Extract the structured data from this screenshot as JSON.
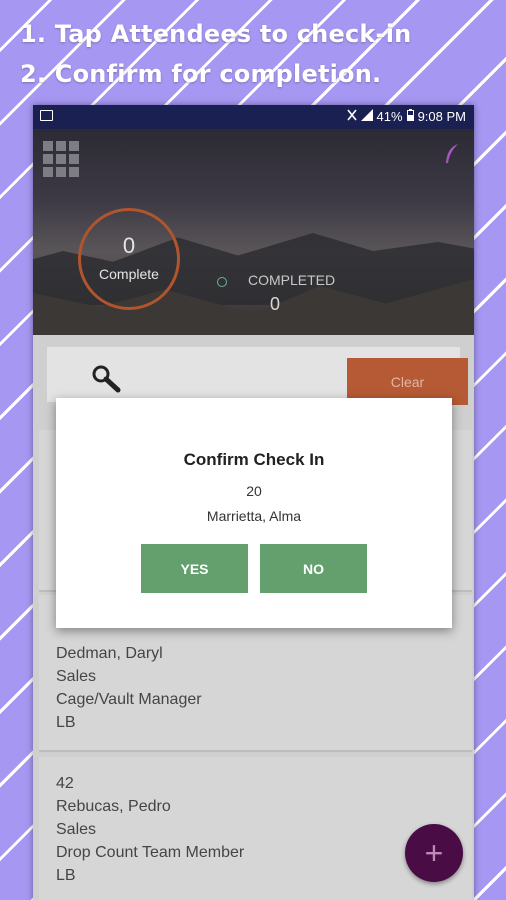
{
  "headline": {
    "line1": "1. Tap Attendees to check-in",
    "line2": "2. Confirm for completion."
  },
  "statusbar": {
    "battery": "41%",
    "time": "9:08 PM"
  },
  "summary": {
    "complete_count": "0",
    "complete_label": "Complete",
    "completed_label": "COMPLETED",
    "completed_count": "0"
  },
  "search": {
    "clear_label": "Clear"
  },
  "attendees": [
    {
      "lines": [
        "Dedman, Daryl",
        "Sales",
        "Cage/Vault Manager",
        "LB"
      ]
    },
    {
      "lines": [
        "42",
        "Rebucas, Pedro",
        "Sales",
        "Drop Count Team Member",
        "LB"
      ]
    }
  ],
  "dialog": {
    "title": "Confirm Check In",
    "number": "20",
    "name": "Marrietta, Alma",
    "yes_label": "YES",
    "no_label": "NO"
  },
  "fab": {
    "symbol": "+"
  },
  "colors": {
    "background": "#a697f2",
    "statusbar": "#1a2152",
    "clear_button": "#b55a34",
    "dialog_button": "#63a06d",
    "fab": "#4a0c45"
  }
}
